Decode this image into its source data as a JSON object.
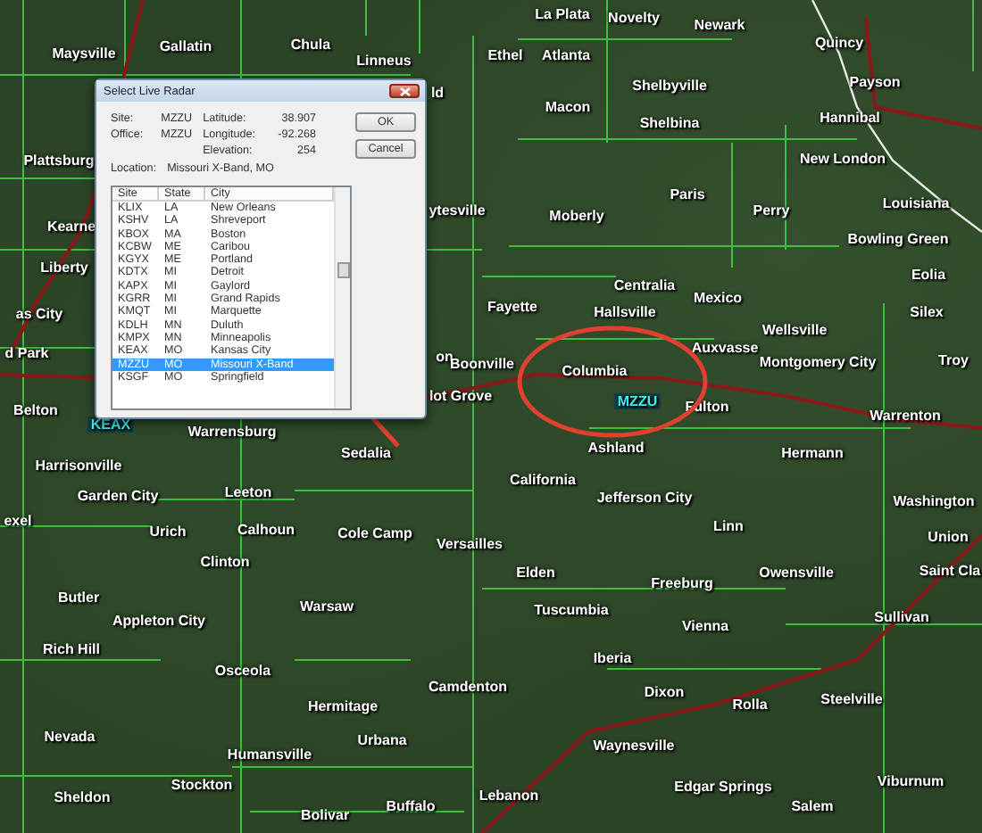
{
  "map": {
    "labels": [
      {
        "name": "La Plata",
        "kind": "town"
      },
      {
        "name": "Novelty",
        "kind": "town"
      },
      {
        "name": "Newark",
        "kind": "town"
      },
      {
        "name": "Maysville",
        "kind": "town"
      },
      {
        "name": "Gallatin",
        "kind": "town"
      },
      {
        "name": "Chula",
        "kind": "town"
      },
      {
        "name": "Linneus",
        "kind": "town"
      },
      {
        "name": "Ethel",
        "kind": "town"
      },
      {
        "name": "Atlanta",
        "kind": "town"
      },
      {
        "name": "Quincy",
        "kind": "town"
      },
      {
        "name": "ld",
        "kind": "town"
      },
      {
        "name": "Shelbyville",
        "kind": "town"
      },
      {
        "name": "Payson",
        "kind": "town"
      },
      {
        "name": "Macon",
        "kind": "town"
      },
      {
        "name": "Shelbina",
        "kind": "town"
      },
      {
        "name": "Hannibal",
        "kind": "town"
      },
      {
        "name": "Plattsburg",
        "kind": "town"
      },
      {
        "name": "New London",
        "kind": "town"
      },
      {
        "name": "Paris",
        "kind": "town"
      },
      {
        "name": "Kearne",
        "kind": "town"
      },
      {
        "name": "ytesville",
        "kind": "town"
      },
      {
        "name": "Moberly",
        "kind": "town"
      },
      {
        "name": "Perry",
        "kind": "town"
      },
      {
        "name": "Louisiana",
        "kind": "town"
      },
      {
        "name": "Bowling Green",
        "kind": "town"
      },
      {
        "name": "Liberty",
        "kind": "town"
      },
      {
        "name": "Eolia",
        "kind": "town"
      },
      {
        "name": "Centralia",
        "kind": "town"
      },
      {
        "name": "Mexico",
        "kind": "town"
      },
      {
        "name": "as City",
        "kind": "town"
      },
      {
        "name": "Fayette",
        "kind": "town"
      },
      {
        "name": "Hallsville",
        "kind": "town"
      },
      {
        "name": "Silex",
        "kind": "town"
      },
      {
        "name": "Wellsville",
        "kind": "town"
      },
      {
        "name": "Auxvasse",
        "kind": "town"
      },
      {
        "name": "d Park",
        "kind": "town"
      },
      {
        "name": "on",
        "kind": "town"
      },
      {
        "name": "Boonville",
        "kind": "town"
      },
      {
        "name": "Montgomery City",
        "kind": "town"
      },
      {
        "name": "Troy",
        "kind": "town"
      },
      {
        "name": "Columbia",
        "kind": "town"
      },
      {
        "name": "lot Grove",
        "kind": "town"
      },
      {
        "name": "Belton",
        "kind": "town"
      },
      {
        "name": "MZZU",
        "kind": "radar"
      },
      {
        "name": "Fulton",
        "kind": "town"
      },
      {
        "name": "Warrenton",
        "kind": "town"
      },
      {
        "name": "KEAX",
        "kind": "radar"
      },
      {
        "name": "Warrensburg",
        "kind": "town"
      },
      {
        "name": "Sedalia",
        "kind": "town"
      },
      {
        "name": "Ashland",
        "kind": "town"
      },
      {
        "name": "Hermann",
        "kind": "town"
      },
      {
        "name": "Harrisonville",
        "kind": "town"
      },
      {
        "name": "California",
        "kind": "town"
      },
      {
        "name": "Garden City",
        "kind": "town"
      },
      {
        "name": "Leeton",
        "kind": "town"
      },
      {
        "name": "Jefferson City",
        "kind": "town"
      },
      {
        "name": "Washington",
        "kind": "town"
      },
      {
        "name": "exel",
        "kind": "town"
      },
      {
        "name": "Urich",
        "kind": "town"
      },
      {
        "name": "Calhoun",
        "kind": "town"
      },
      {
        "name": "Cole Camp",
        "kind": "town"
      },
      {
        "name": "Versailles",
        "kind": "town"
      },
      {
        "name": "Linn",
        "kind": "town"
      },
      {
        "name": "Union",
        "kind": "town"
      },
      {
        "name": "Clinton",
        "kind": "town"
      },
      {
        "name": "Elden",
        "kind": "town"
      },
      {
        "name": "Freeburg",
        "kind": "town"
      },
      {
        "name": "Owensville",
        "kind": "town"
      },
      {
        "name": "Saint Cla",
        "kind": "town"
      },
      {
        "name": "Butler",
        "kind": "town"
      },
      {
        "name": "Appleton City",
        "kind": "town"
      },
      {
        "name": "Warsaw",
        "kind": "town"
      },
      {
        "name": "Tuscumbia",
        "kind": "town"
      },
      {
        "name": "Vienna",
        "kind": "town"
      },
      {
        "name": "Sullivan",
        "kind": "town"
      },
      {
        "name": "Rich Hill",
        "kind": "town"
      },
      {
        "name": "Osceola",
        "kind": "town"
      },
      {
        "name": "Iberia",
        "kind": "town"
      },
      {
        "name": "Camdenton",
        "kind": "town"
      },
      {
        "name": "Hermitage",
        "kind": "town"
      },
      {
        "name": "Dixon",
        "kind": "town"
      },
      {
        "name": "Rolla",
        "kind": "town"
      },
      {
        "name": "Steelville",
        "kind": "town"
      },
      {
        "name": "Nevada",
        "kind": "town"
      },
      {
        "name": "Humansville",
        "kind": "town"
      },
      {
        "name": "Urbana",
        "kind": "town"
      },
      {
        "name": "Waynesville",
        "kind": "town"
      },
      {
        "name": "Sheldon",
        "kind": "town"
      },
      {
        "name": "Stockton",
        "kind": "town"
      },
      {
        "name": "Bolivar",
        "kind": "town"
      },
      {
        "name": "Buffalo",
        "kind": "town"
      },
      {
        "name": "Lebanon",
        "kind": "town"
      },
      {
        "name": "Edgar Springs",
        "kind": "town"
      },
      {
        "name": "Salem",
        "kind": "town"
      },
      {
        "name": "Viburnum",
        "kind": "town"
      }
    ]
  },
  "dialog": {
    "title": "Select Live Radar",
    "fields": [
      {
        "label": "Site:",
        "value": "MZZU"
      },
      {
        "label": "Office:",
        "value": "MZZU"
      }
    ],
    "coords": [
      {
        "label": "Latitude:",
        "value": "38.907"
      },
      {
        "label": "Longitude:",
        "value": "-92.268"
      },
      {
        "label": "Elevation:",
        "value": "254"
      }
    ],
    "location": {
      "label": "Location:",
      "value": "Missouri X-Band, MO"
    },
    "buttons": [
      "OK",
      "Cancel"
    ],
    "columns": [
      "Site",
      "State",
      "City"
    ],
    "rows": [
      {
        "site": "KLIX",
        "state": "LA",
        "city": "New Orleans",
        "selected": false
      },
      {
        "site": "KSHV",
        "state": "LA",
        "city": "Shreveport",
        "selected": false
      },
      {
        "site": "KBOX",
        "state": "MA",
        "city": "Boston",
        "selected": false
      },
      {
        "site": "KCBW",
        "state": "ME",
        "city": "Caribou",
        "selected": false
      },
      {
        "site": "KGYX",
        "state": "ME",
        "city": "Portland",
        "selected": false
      },
      {
        "site": "KDTX",
        "state": "MI",
        "city": "Detroit",
        "selected": false
      },
      {
        "site": "KAPX",
        "state": "MI",
        "city": "Gaylord",
        "selected": false
      },
      {
        "site": "KGRR",
        "state": "MI",
        "city": "Grand Rapids",
        "selected": false
      },
      {
        "site": "KMQT",
        "state": "MI",
        "city": "Marquette",
        "selected": false
      },
      {
        "site": "KDLH",
        "state": "MN",
        "city": "Duluth",
        "selected": false
      },
      {
        "site": "KMPX",
        "state": "MN",
        "city": "Minneapolis",
        "selected": false
      },
      {
        "site": "KEAX",
        "state": "MO",
        "city": "Kansas City",
        "selected": false
      },
      {
        "site": "MZZU",
        "state": "MO",
        "city": "Missouri X-Band",
        "selected": true
      },
      {
        "site": "KSGF",
        "state": "MO",
        "city": "Springfield",
        "selected": false
      }
    ]
  }
}
